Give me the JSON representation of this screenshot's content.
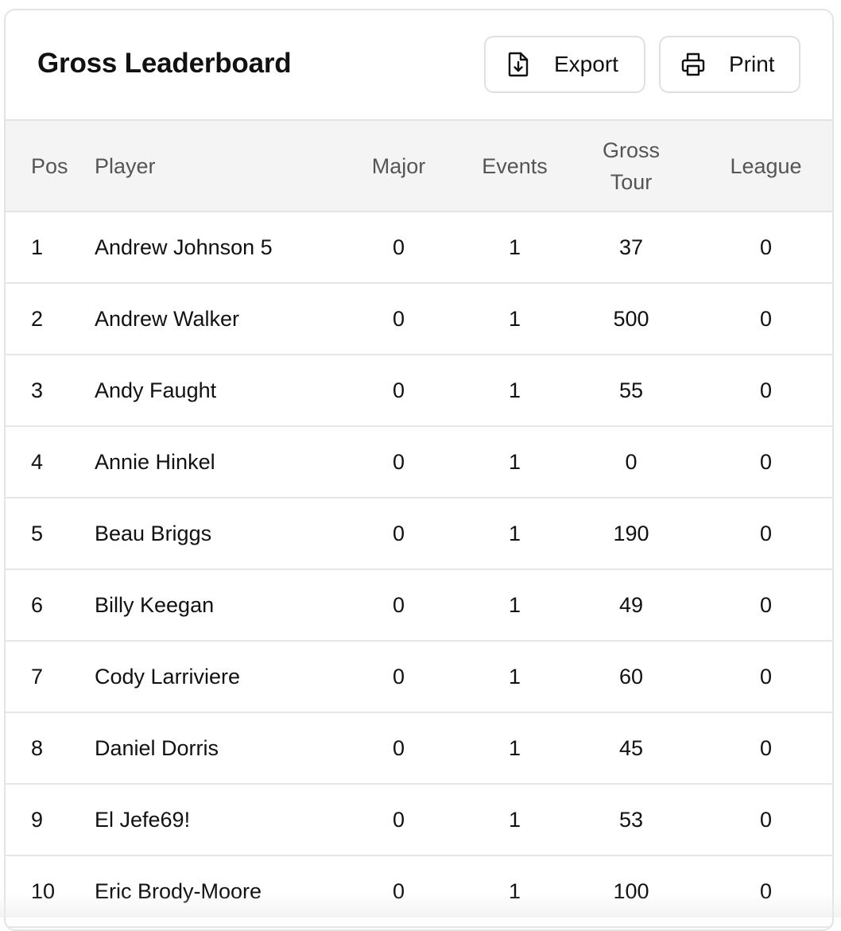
{
  "header": {
    "title": "Gross Leaderboard",
    "export_label": "Export",
    "print_label": "Print"
  },
  "table": {
    "columns": {
      "pos": "Pos",
      "player": "Player",
      "major": "Major",
      "events": "Events",
      "gross_tour_line1": "Gross",
      "gross_tour_line2": "Tour",
      "league": "League"
    },
    "rows": [
      {
        "pos": "1",
        "player": "Andrew Johnson 5",
        "major": "0",
        "events": "1",
        "gross_tour": "37",
        "league": "0"
      },
      {
        "pos": "2",
        "player": "Andrew Walker",
        "major": "0",
        "events": "1",
        "gross_tour": "500",
        "league": "0"
      },
      {
        "pos": "3",
        "player": "Andy Faught",
        "major": "0",
        "events": "1",
        "gross_tour": "55",
        "league": "0"
      },
      {
        "pos": "4",
        "player": "Annie Hinkel",
        "major": "0",
        "events": "1",
        "gross_tour": "0",
        "league": "0"
      },
      {
        "pos": "5",
        "player": "Beau Briggs",
        "major": "0",
        "events": "1",
        "gross_tour": "190",
        "league": "0"
      },
      {
        "pos": "6",
        "player": "Billy Keegan",
        "major": "0",
        "events": "1",
        "gross_tour": "49",
        "league": "0"
      },
      {
        "pos": "7",
        "player": "Cody Larriviere",
        "major": "0",
        "events": "1",
        "gross_tour": "60",
        "league": "0"
      },
      {
        "pos": "8",
        "player": "Daniel Dorris",
        "major": "0",
        "events": "1",
        "gross_tour": "45",
        "league": "0"
      },
      {
        "pos": "9",
        "player": "El Jefe69!",
        "major": "0",
        "events": "1",
        "gross_tour": "53",
        "league": "0"
      },
      {
        "pos": "10",
        "player": "Eric Brody-Moore",
        "major": "0",
        "events": "1",
        "gross_tour": "100",
        "league": "0"
      }
    ]
  },
  "icons": {
    "export": "file-download-icon",
    "print": "printer-icon"
  }
}
